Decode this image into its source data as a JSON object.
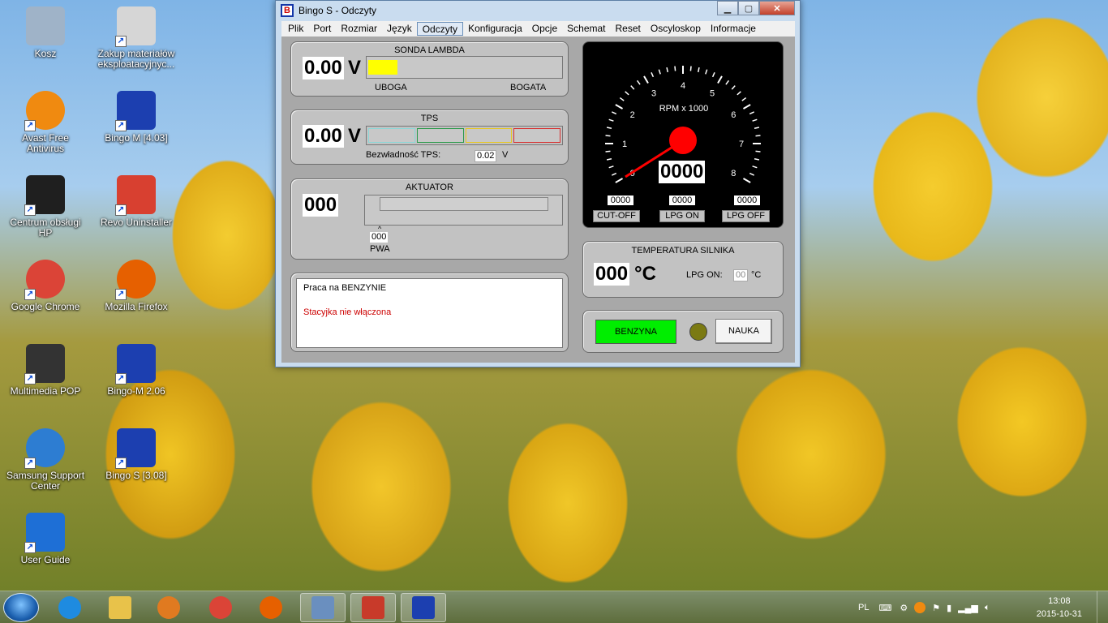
{
  "desktop": {
    "icons": [
      {
        "label": "Kosz",
        "icon": "recycle-bin-icon"
      },
      {
        "label": "Zakup materiałów eksploatacyjnyc...",
        "icon": "printer-supplies-icon"
      },
      {
        "label": "Avast Free Antivirus",
        "icon": "avast-icon"
      },
      {
        "label": "Bingo M [4.03]",
        "icon": "bingo-m-icon"
      },
      {
        "label": "Centrum obsługi HP",
        "icon": "hp-icon"
      },
      {
        "label": "Revo Uninstaller",
        "icon": "revo-uninstaller-icon"
      },
      {
        "label": "Google Chrome",
        "icon": "chrome-icon"
      },
      {
        "label": "Mozilla Firefox",
        "icon": "firefox-icon"
      },
      {
        "label": "Multimedia POP",
        "icon": "laptop-icon"
      },
      {
        "label": "Bingo-M 2.06",
        "icon": "bingo-m-icon"
      },
      {
        "label": "Samsung Support Center",
        "icon": "samsung-support-icon"
      },
      {
        "label": "Bingo S [3.08]",
        "icon": "bingo-s-icon"
      },
      {
        "label": "User Guide",
        "icon": "user-guide-icon"
      }
    ]
  },
  "window": {
    "title": "Bingo S - Odczyty",
    "logo_letter": "B",
    "menu": [
      "Plik",
      "Port",
      "Rozmiar",
      "Język",
      "Odczyty",
      "Konfiguracja",
      "Opcje",
      "Schemat",
      "Reset",
      "Oscyloskop",
      "Informacje"
    ],
    "active_menu": "Odczyty"
  },
  "lambda": {
    "title": "SONDA LAMBDA",
    "value": "0.00",
    "unit": "V",
    "left_label": "UBOGA",
    "right_label": "BOGATA",
    "level": 0.15,
    "bar_color": "#ffff00"
  },
  "tps": {
    "title": "TPS",
    "value": "0.00",
    "unit": "V",
    "inertia_label": "Bezwładność TPS:",
    "inertia_value": "0.02",
    "inertia_unit": "V",
    "segment_colors": [
      "#8ad8d8",
      "#2a9a4a",
      "#e8c820",
      "#d83030"
    ]
  },
  "actuator": {
    "title": "AKTUATOR",
    "value": "000",
    "pwa_value": "000",
    "pwa_label": "PWA",
    "marker": "^"
  },
  "messages": {
    "line1": "Praca na BENZYNIE",
    "line2": "Stacyjka nie włączona",
    "line2_color": "#cc0000"
  },
  "rpm_gauge": {
    "label": "RPM x 1000",
    "value": "0000",
    "ticks": [
      "0",
      "1",
      "2",
      "3",
      "4",
      "5",
      "6",
      "7",
      "8"
    ],
    "needle_value": 0,
    "cutoff_value": "0000",
    "cutoff_label": "CUT-OFF",
    "lpg_on_value": "0000",
    "lpg_on_label": "LPG ON",
    "lpg_off_value": "0000",
    "lpg_off_label": "LPG OFF",
    "needle_color": "#ff0000"
  },
  "temperature": {
    "title": "TEMPERATURA SILNIKA",
    "value": "000",
    "unit": "°C",
    "lpg_on_label": "LPG ON:",
    "lpg_on_value": "00",
    "lpg_on_unit": "°C"
  },
  "fuel": {
    "mode_button": "BENZYNA",
    "mode_color": "#00ee00",
    "learn_button": "NAUKA"
  },
  "taskbar": {
    "apps": [
      "internet-explorer-icon",
      "file-explorer-icon",
      "media-player-icon",
      "chrome-icon",
      "firefox-icon",
      "control-panel-icon",
      "toolbox-icon",
      "bingo-s-icon"
    ],
    "lang": "PL",
    "time": "13:08",
    "date": "2015-10-31"
  }
}
